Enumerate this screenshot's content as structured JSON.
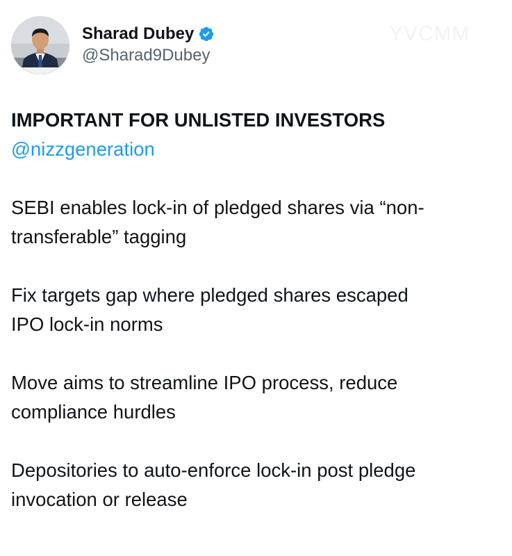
{
  "author": {
    "display_name": "Sharad Dubey",
    "handle": "@Sharad9Dubey",
    "verified": true,
    "avatar_icon": "profile-photo"
  },
  "watermark_text": "YVCMM",
  "post": {
    "headline": "IMPORTANT FOR UNLISTED INVESTORS",
    "mention": "@nizzgeneration",
    "paragraphs": [
      [
        "SEBI enables lock-in of pledged shares via “non-",
        "transferable” tagging"
      ],
      [
        "Fix targets gap where pledged shares escaped",
        "IPO lock-in norms"
      ],
      [
        "Move aims to streamline IPO process, reduce",
        "compliance hurdles"
      ],
      [
        "Depositories to auto-enforce lock-in post pledge",
        "invocation or release"
      ]
    ]
  },
  "colors": {
    "text": "#0f1419",
    "secondary": "#536471",
    "link": "#1d9bf0",
    "verified": "#1d9bf0",
    "background": "#ffffff"
  }
}
